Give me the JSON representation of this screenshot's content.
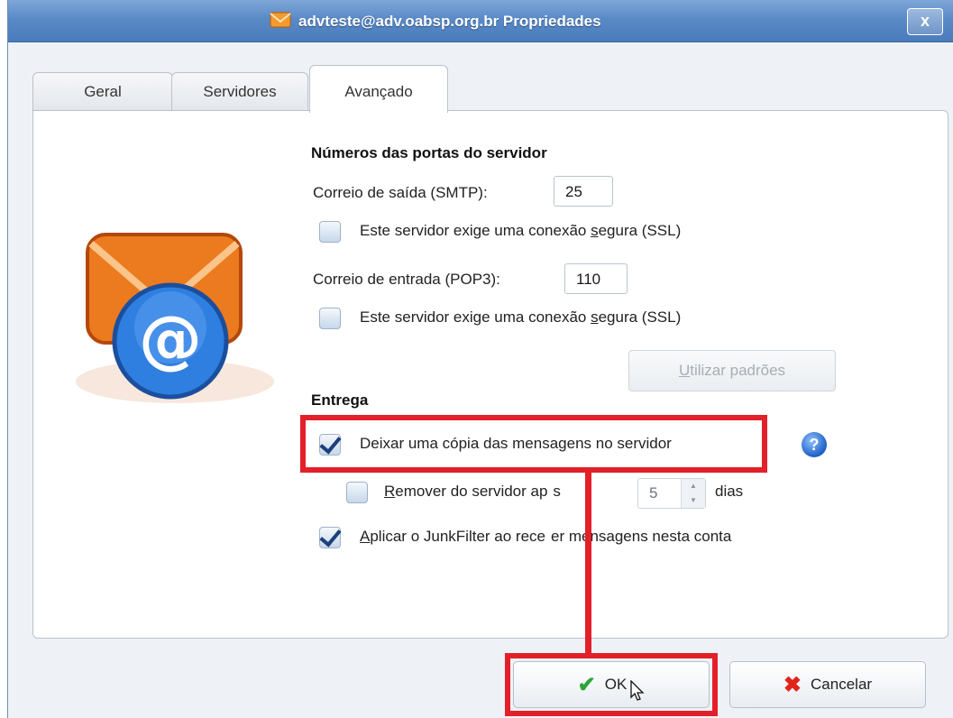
{
  "window": {
    "title": "advteste@adv.oabsp.org.br Propriedades",
    "close_label": "x"
  },
  "tabs": [
    {
      "label": "Geral"
    },
    {
      "label": "Servidores"
    },
    {
      "label": "Avançado",
      "active": true
    }
  ],
  "ports": {
    "heading": "Números das portas do servidor",
    "smtp_label": "Correio de saída (SMTP):",
    "smtp_value": "25",
    "smtp_ssl": {
      "pre": "Este servidor exige uma conexão ",
      "u": "s",
      "post": "egura (SSL)",
      "checked": false
    },
    "pop3_label": "Correio de entrada (POP3):",
    "pop3_value": "110",
    "pop3_ssl": {
      "pre": "Este servidor exige uma conexão ",
      "u": "s",
      "post": "egura (SSL)",
      "checked": false
    },
    "defaults_button": {
      "u": "U",
      "rest": "tilizar padrões",
      "enabled": false
    }
  },
  "delivery": {
    "heading": "Entrega",
    "leave_copy": {
      "label": "Deixar uma cópia das mensagens no servidor",
      "checked": true
    },
    "remove_after": {
      "u": "R",
      "pre": "emover do servidor ap",
      "post": "s",
      "checked": false,
      "days_value": "5",
      "days_label": "dias"
    },
    "junkfilter": {
      "u": "A",
      "pre": "plicar o JunkFilter ao rece",
      "post": "er mensagens nesta conta",
      "checked": true
    }
  },
  "buttons": {
    "ok": "OK",
    "cancel": "Cancelar"
  },
  "colors": {
    "highlight": "#e3202a",
    "titlebar": "#5a8ac6"
  }
}
